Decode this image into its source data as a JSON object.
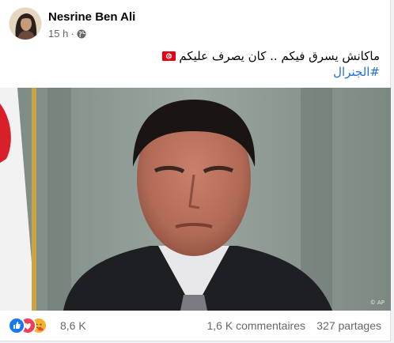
{
  "post": {
    "author": "Nesrine Ben Ali",
    "time": "15 h",
    "separator": "·",
    "text_line1": "ماكانش يسرق فيكم .. كان يصرف عليكم",
    "hashtag": "#الجنرال",
    "photo_credit": "© AP"
  },
  "icons": {
    "privacy": "globe-icon",
    "flag": "tunisia-flag-icon",
    "reactions": [
      "like-icon",
      "love-icon",
      "care-icon"
    ]
  },
  "stats": {
    "reactions_count": "8,6 K",
    "comments": "1,6 K commentaires",
    "shares": "327 partages"
  },
  "colors": {
    "link": "#216fdb",
    "like": "#1877f2",
    "love": "#f33e58",
    "care": "#f7b125",
    "secondary_text": "#65676b"
  }
}
